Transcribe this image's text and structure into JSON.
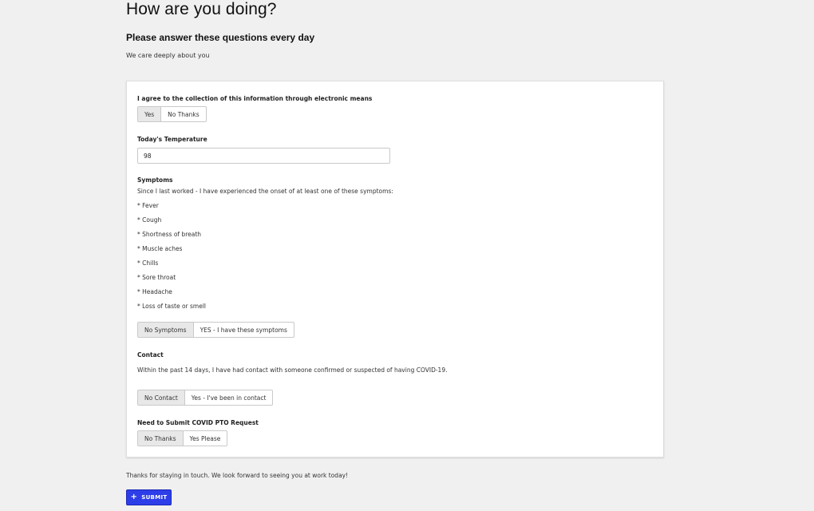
{
  "header": {
    "title": "How are you doing?",
    "subtitle": "Please answer these questions every day",
    "description": "We care deeply about you"
  },
  "consent": {
    "label": "I agree to the collection of this information through electronic means",
    "options": [
      "Yes",
      "No Thanks"
    ],
    "selected": "Yes"
  },
  "temperature": {
    "label": "Today's Temperature",
    "value": "98"
  },
  "symptoms": {
    "label": "Symptoms",
    "intro": "Since I last worked - I have experienced the onset of at least one of these symptoms:",
    "items": [
      "* Fever",
      "* Cough",
      "* Shortness of breath",
      "* Muscle aches",
      "* Chills",
      "* Sore throat",
      "* Headache",
      "* Loss of taste or smell"
    ],
    "options": [
      "No Symptoms",
      "YES - I have these symptoms"
    ],
    "selected": "No Symptoms"
  },
  "contact": {
    "label": "Contact",
    "text": "Within the past 14 days, I have had contact with someone confirmed or suspected of having COVID-19.",
    "options": [
      "No Contact",
      "Yes - I've been in contact"
    ],
    "selected": "No Contact"
  },
  "pto": {
    "label": "Need to Submit COVID PTO Request",
    "options": [
      "No Thanks",
      "Yes Please"
    ],
    "selected": "No Thanks"
  },
  "footer": {
    "text": "Thanks for staying in touch.  We look forward to seeing you at work today!",
    "submit_label": "SUBMIT",
    "submit_icon": "plus-icon",
    "submit_color": "#2d3ee8"
  }
}
